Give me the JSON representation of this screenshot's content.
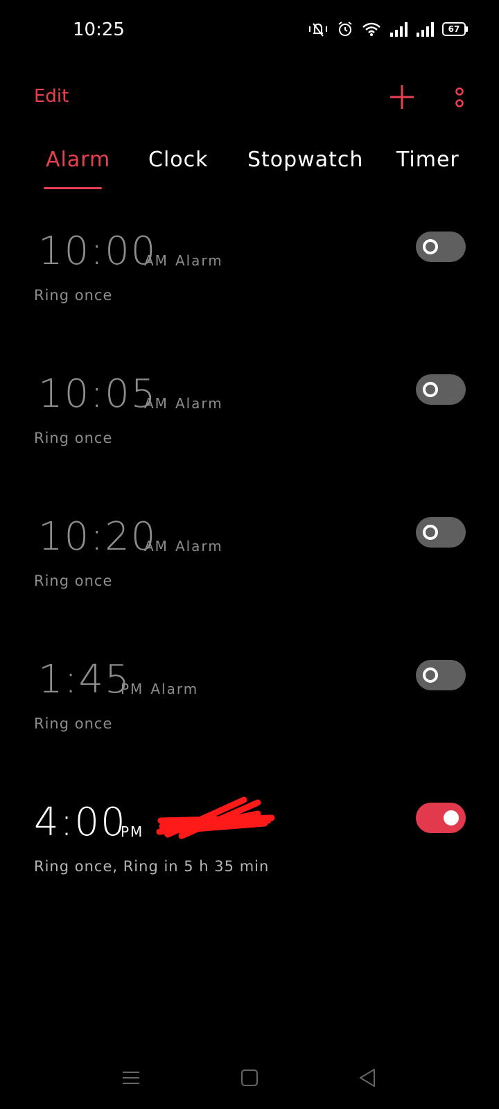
{
  "status_bar": {
    "time": "10:25",
    "battery": "67",
    "icons": [
      "mute-vibrate-icon",
      "alarm-clock-icon",
      "wifi-icon",
      "signal-icon",
      "signal-icon-2",
      "battery-icon"
    ]
  },
  "toolbar": {
    "edit_label": "Edit",
    "add_icon": "plus-icon",
    "more_icon": "more-vertical-icon"
  },
  "tabs": [
    {
      "label": "Alarm",
      "active": true
    },
    {
      "label": "Clock",
      "active": false
    },
    {
      "label": "Stopwatch",
      "active": false
    },
    {
      "label": "Timer",
      "active": false
    }
  ],
  "alarms": [
    {
      "time": "10:00",
      "period": "AM",
      "label": "Alarm",
      "repeat": "Ring once",
      "enabled": false
    },
    {
      "time": "10:05",
      "period": "AM",
      "label": "Alarm",
      "repeat": "Ring once",
      "enabled": false
    },
    {
      "time": "10:20",
      "period": "AM",
      "label": "Alarm",
      "repeat": "Ring once",
      "enabled": false
    },
    {
      "time": "1:45",
      "period": "PM",
      "label": "Alarm",
      "repeat": "Ring once",
      "enabled": false
    },
    {
      "time": "4:00",
      "period": "PM",
      "label": "",
      "repeat": "Ring once, Ring in 5 h 35 min",
      "enabled": true
    }
  ],
  "colors": {
    "accent": "#e8404f",
    "toggle_on": "#e23a4c",
    "toggle_off": "#5f5f5f",
    "dim_text": "#8c8c8c"
  },
  "navbar": {
    "icons": [
      "menu-icon",
      "home-square-icon",
      "back-triangle-icon"
    ]
  }
}
